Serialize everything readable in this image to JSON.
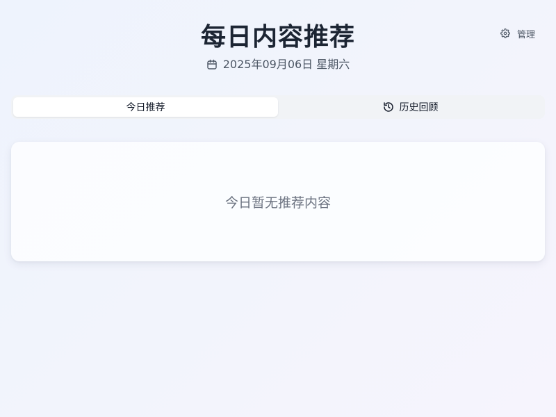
{
  "header": {
    "title": "每日内容推荐",
    "date": "2025年09月06日 星期六",
    "date_icon": "calendar-icon",
    "manage_label": "管理",
    "manage_icon": "gear-icon"
  },
  "tabs": [
    {
      "label": "今日推荐",
      "active": true
    },
    {
      "label": "历史回顾",
      "active": false,
      "icon": "history-icon"
    }
  ],
  "content": {
    "empty_message": "今日暂无推荐内容"
  },
  "colors": {
    "title": "#1c2533",
    "muted": "#6b7280",
    "tab_bg": "#f1f3f6",
    "card_bg": "#fcfdff"
  }
}
